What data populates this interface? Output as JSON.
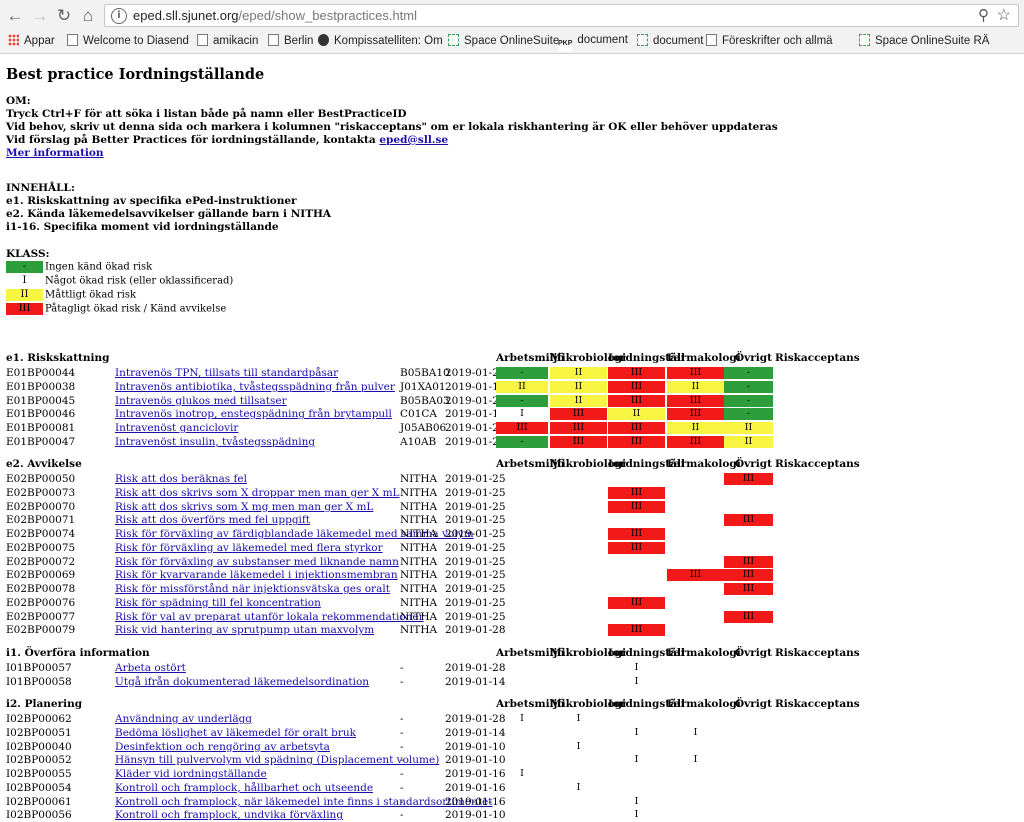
{
  "browser": {
    "url_host": "eped.sll.sjunet.org",
    "url_path": "/eped/show_bestpractices.html",
    "bookmarks": [
      {
        "label": "Appar",
        "icon": "apps-grid-icon"
      },
      {
        "label": "Welcome to Diasend",
        "icon": "page-icon"
      },
      {
        "label": "amikacin",
        "icon": "page-icon"
      },
      {
        "label": "Berlin",
        "icon": "page-icon"
      },
      {
        "label": "Kompissatelliten: Om",
        "icon": "circle-logo-icon"
      },
      {
        "label": "Space OnlineSuite",
        "icon": "dashed-square-icon"
      },
      {
        "label": "document",
        "icon": "pkp-logo-icon",
        "prefix": "PKP"
      },
      {
        "label": "document",
        "icon": "dashed-square-icon"
      },
      {
        "label": "Föreskrifter och allmä",
        "icon": "page-icon"
      },
      {
        "label": "Space OnlineSuite RÄ",
        "icon": "dashed-square-icon"
      }
    ]
  },
  "page": {
    "title": "Best practice Iordningställande",
    "about": {
      "heading": "OM:",
      "lines": [
        "Tryck Ctrl+F för att söka i listan både på namn eller BestPracticeID",
        "Vid behov, skriv ut denna sida och markera i kolumnen \"riskacceptans\" om er lokala riskhantering är OK eller behöver uppdateras",
        "Vid förslag på Better Practices för iordningställande, kontakta "
      ],
      "contact_email": "eped@sll.se",
      "more_link": "Mer information"
    },
    "contents": {
      "heading": "INNEHÅLL:",
      "items": [
        "e1. Riskskattning av specifika ePed-instruktioner",
        "e2. Kända läkemedelsavvikelser gällande barn i NITHA",
        "i1-16. Specifika moment vid iordningställande"
      ]
    },
    "legend": {
      "heading": "KLASS:",
      "items": [
        {
          "mark": "-",
          "color": "#2e9e3c",
          "label": "Ingen känd ökad risk"
        },
        {
          "mark": "I",
          "color": "#ffffff",
          "label": "Något ökad risk (eller oklassificerad)"
        },
        {
          "mark": "II",
          "color": "#f7f542",
          "label": "Måttligt ökad risk"
        },
        {
          "mark": "III",
          "color": "#f21919",
          "label": "Påtagligt ökad risk / Känd avvikelse"
        }
      ]
    },
    "columns": [
      "Arbetsmiljö",
      "Mikrobiologi",
      "Iordningställ",
      "Farmakologi",
      "Övrigt",
      "Riskacceptans"
    ],
    "sections": [
      {
        "title": "e1. Riskskattning",
        "rows": [
          {
            "id": "E01BP00044",
            "name": "Intravenös TPN, tillsats till standardpåsar",
            "code": "B05BA10",
            "date": "2019-01-28",
            "cells": [
              "-",
              "II",
              "III",
              "III",
              "-"
            ]
          },
          {
            "id": "E01BP00038",
            "name": "Intravenös antibiotika, tvåstegsspädning från pulver",
            "code": "J01XA01",
            "date": "2019-01-18",
            "cells": [
              "II",
              "II",
              "III",
              "II",
              "-"
            ]
          },
          {
            "id": "E01BP00045",
            "name": "Intravenös glukos med tillsatser",
            "code": "B05BA03",
            "date": "2019-01-28",
            "cells": [
              "-",
              "II",
              "III",
              "III",
              "-"
            ]
          },
          {
            "id": "E01BP00046",
            "name": "Intravenös inotrop, enstegspädning från brytampull",
            "code": "C01CA",
            "date": "2019-01-10",
            "cells": [
              "I",
              "III",
              "II",
              "III",
              "-"
            ]
          },
          {
            "id": "E01BP00081",
            "name": "Intravenöst ganciclovir",
            "code": "J05AB06",
            "date": "2019-01-28",
            "cells": [
              "III",
              "III",
              "III",
              "II",
              "II"
            ]
          },
          {
            "id": "E01BP00047",
            "name": "Intravenöst insulin, tvåstegsspädning",
            "code": "A10AB",
            "date": "2019-01-28",
            "cells": [
              "-",
              "III",
              "III",
              "III",
              "II"
            ]
          }
        ]
      },
      {
        "title": "e2. Avvikelse",
        "rows": [
          {
            "id": "E02BP00050",
            "name": "Risk att dos beräknas fel",
            "code": "NITHA",
            "date": "2019-01-25",
            "cells": [
              "",
              "",
              "",
              "",
              "III"
            ]
          },
          {
            "id": "E02BP00073",
            "name": "Risk att dos skrivs som X droppar men man ger X mL",
            "code": "NITHA",
            "date": "2019-01-25",
            "cells": [
              "",
              "",
              "III",
              "",
              ""
            ]
          },
          {
            "id": "E02BP00070",
            "name": "Risk att dos skrivs som X mg men man ger X mL",
            "code": "NITHA",
            "date": "2019-01-25",
            "cells": [
              "",
              "",
              "III",
              "",
              ""
            ]
          },
          {
            "id": "E02BP00071",
            "name": "Risk att dos överförs med fel uppgift",
            "code": "NITHA",
            "date": "2019-01-25",
            "cells": [
              "",
              "",
              "",
              "",
              "III"
            ]
          },
          {
            "id": "E02BP00074",
            "name": "Risk för förväxling av färdigblandade läkemedel med samma volym",
            "code": "NITHA",
            "date": "2019-01-25",
            "cells": [
              "",
              "",
              "III",
              "",
              ""
            ]
          },
          {
            "id": "E02BP00075",
            "name": "Risk för förväxling av läkemedel med flera styrkor",
            "code": "NITHA",
            "date": "2019-01-25",
            "cells": [
              "",
              "",
              "III",
              "",
              ""
            ]
          },
          {
            "id": "E02BP00072",
            "name": "Risk för förväxling av substanser med liknande namn",
            "code": "NITHA",
            "date": "2019-01-25",
            "cells": [
              "",
              "",
              "",
              "",
              "III"
            ]
          },
          {
            "id": "E02BP00069",
            "name": "Risk för kvarvarande läkemedel i injektionsmembran",
            "code": "NITHA",
            "date": "2019-01-25",
            "cells": [
              "",
              "",
              "",
              "III",
              "III"
            ]
          },
          {
            "id": "E02BP00078",
            "name": "Risk för missförstånd när injektionsvätska ges oralt",
            "code": "NITHA",
            "date": "2019-01-25",
            "cells": [
              "",
              "",
              "",
              "",
              "III"
            ]
          },
          {
            "id": "E02BP00076",
            "name": "Risk för spädning till fel koncentration",
            "code": "NITHA",
            "date": "2019-01-25",
            "cells": [
              "",
              "",
              "III",
              "",
              ""
            ]
          },
          {
            "id": "E02BP00077",
            "name": "Risk för val av preparat utanför lokala rekommendationer",
            "code": "NITHA",
            "date": "2019-01-25",
            "cells": [
              "",
              "",
              "",
              "",
              "III"
            ]
          },
          {
            "id": "E02BP00079",
            "name": "Risk vid hantering av sprutpump utan maxvolym",
            "code": "NITHA",
            "date": "2019-01-28",
            "cells": [
              "",
              "",
              "III",
              "",
              ""
            ]
          }
        ]
      },
      {
        "title": "i1. Överföra information",
        "rows": [
          {
            "id": "I01BP00057",
            "name": "Arbeta ostört",
            "code": "-",
            "date": "2019-01-28",
            "cells": [
              "",
              "",
              "I",
              "",
              ""
            ]
          },
          {
            "id": "I01BP00058",
            "name": "Utgå ifrån dokumenterad läkemedelsordination",
            "code": "-",
            "date": "2019-01-14",
            "cells": [
              "",
              "",
              "I",
              "",
              ""
            ]
          }
        ]
      },
      {
        "title": "i2. Planering",
        "rows": [
          {
            "id": "I02BP00062",
            "name": "Användning av underlägg",
            "code": "-",
            "date": "2019-01-28",
            "cells": [
              "I",
              "I",
              "",
              "",
              ""
            ]
          },
          {
            "id": "I02BP00051",
            "name": "Bedöma löslighet av läkemedel för oralt bruk",
            "code": "-",
            "date": "2019-01-14",
            "cells": [
              "",
              "",
              "I",
              "I",
              ""
            ]
          },
          {
            "id": "I02BP00040",
            "name": "Desinfektion och rengöring av arbetsyta",
            "code": "-",
            "date": "2019-01-10",
            "cells": [
              "",
              "I",
              "",
              "",
              ""
            ]
          },
          {
            "id": "I02BP00052",
            "name": "Hänsyn till pulvervolym vid spädning (Displacement volume)",
            "code": "-",
            "date": "2019-01-10",
            "cells": [
              "",
              "",
              "I",
              "I",
              ""
            ]
          },
          {
            "id": "I02BP00055",
            "name": "Kläder vid iordningställande",
            "code": "-",
            "date": "2019-01-16",
            "cells": [
              "I",
              "",
              "",
              "",
              ""
            ]
          },
          {
            "id": "I02BP00054",
            "name": "Kontroll och framplock, hållbarhet och utseende",
            "code": "-",
            "date": "2019-01-16",
            "cells": [
              "",
              "I",
              "",
              "",
              ""
            ]
          },
          {
            "id": "I02BP00061",
            "name": "Kontroll och framplock, när läkemedel inte finns i standardsortimentet",
            "code": "-",
            "date": "2019-01-16",
            "cells": [
              "",
              "",
              "I",
              "",
              ""
            ]
          },
          {
            "id": "I02BP00056",
            "name": "Kontroll och framplock, undvika förväxling",
            "code": "-",
            "date": "2019-01-10",
            "cells": [
              "",
              "",
              "I",
              "",
              ""
            ]
          }
        ]
      }
    ]
  }
}
